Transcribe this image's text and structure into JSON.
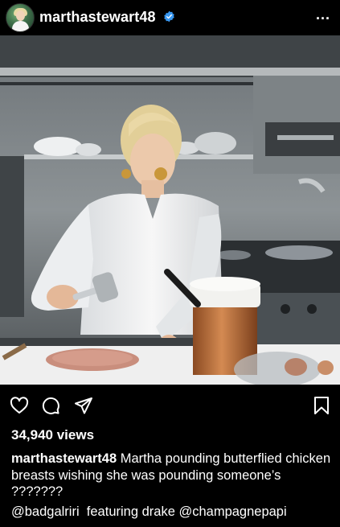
{
  "post": {
    "username": "marthastewart48",
    "verified": true,
    "more_label": "...",
    "views": "34,940 views",
    "caption_user": "marthastewart48",
    "caption_text": "Martha pounding butterflied chicken breasts wishing she was pounding someone’s ???????",
    "tag_1": "@badgalriri",
    "tag_middle": "featuring drake",
    "tag_2": "@champagnepapi"
  },
  "colors": {
    "background": "#000000",
    "text": "#ffffff",
    "verified_badge": "#3897f0"
  },
  "icons": [
    "heart-icon",
    "comment-icon",
    "share-icon",
    "bookmark-icon",
    "verified-icon",
    "more-icon"
  ]
}
